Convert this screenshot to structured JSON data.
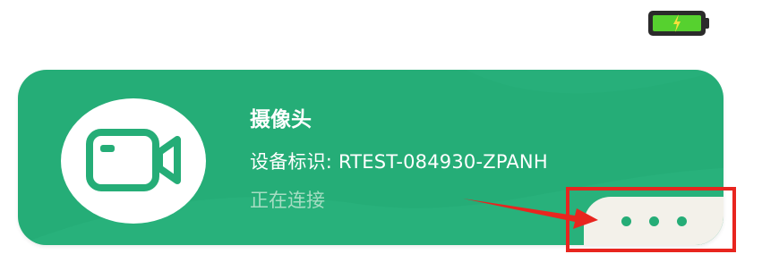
{
  "status_bar": {
    "battery_icon": "battery-charging-icon",
    "battery_level": 1.0,
    "battery_color": "#56d12f"
  },
  "device_card": {
    "background_color": "#25ad77",
    "icon": "video-camera-icon",
    "name": "摄像头",
    "id_text": "设备标识: RTEST-084930-ZPANH",
    "status": "正在连接",
    "more_button_icon": "more-dots-icon"
  },
  "annotation": {
    "highlight_color": "#e8251f"
  }
}
